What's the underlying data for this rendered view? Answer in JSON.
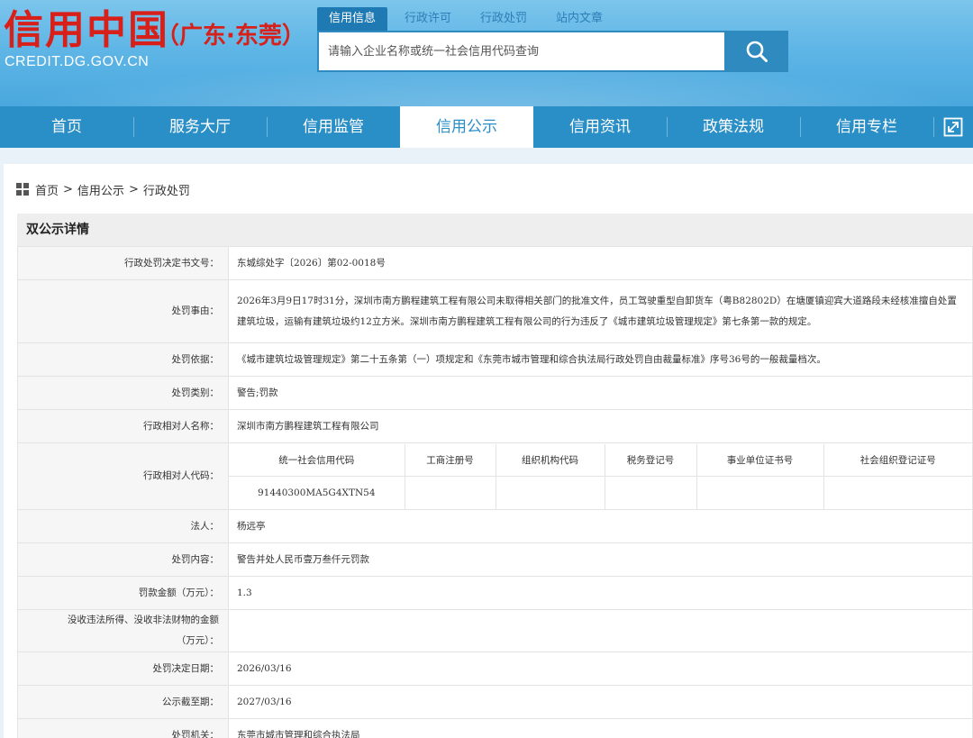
{
  "header": {
    "logo_title": "信用中国",
    "logo_region": "（广东·东莞）",
    "logo_url": "CREDIT.DG.GOV.CN",
    "search_tabs": [
      "信用信息",
      "行政许可",
      "行政处罚",
      "站内文章"
    ],
    "search_placeholder": "请输入企业名称或统一社会信用代码查询",
    "search_icon": "search-icon"
  },
  "nav": {
    "items": [
      "首页",
      "服务大厅",
      "信用监管",
      "信用公示",
      "信用资讯",
      "政策法规",
      "信用专栏"
    ],
    "active_index": 3,
    "expand_icon": "expand-icon"
  },
  "breadcrumb": [
    "首页",
    "信用公示",
    "行政处罚"
  ],
  "detail": {
    "title": "双公示详情",
    "rows": {
      "decision_no": {
        "label": "行政处罚决定书文号：",
        "value": "东城综处字〔2026〕第02-0018号"
      },
      "reason": {
        "label": "处罚事由：",
        "value": "2026年3月9日17时31分，深圳市南方鹏程建筑工程有限公司未取得相关部门的批准文件，员工驾驶重型自卸货车（粤B82802D）在塘厦镇迎宾大道路段未经核准擅自处置建筑垃圾，运输有建筑垃圾约12立方米。深圳市南方鹏程建筑工程有限公司的行为违反了《城市建筑垃圾管理规定》第七条第一款的规定。"
      },
      "basis": {
        "label": "处罚依据：",
        "value": "《城市建筑垃圾管理规定》第二十五条第（一）项规定和《东莞市城市管理和综合执法局行政处罚自由裁量标准》序号36号的一般裁量档次。"
      },
      "category": {
        "label": "处罚类别：",
        "value": "警告;罚款"
      },
      "party_name": {
        "label": "行政相对人名称：",
        "value": "深圳市南方鹏程建筑工程有限公司"
      },
      "party_code": {
        "label": "行政相对人代码：",
        "headers": [
          "统一社会信用代码",
          "工商注册号",
          "组织机构代码",
          "税务登记号",
          "事业单位证书号",
          "社会组织登记证号"
        ],
        "values": [
          "91440300MA5G4XTN54",
          "",
          "",
          "",
          "",
          ""
        ]
      },
      "legal_person": {
        "label": "法人：",
        "value": "杨远亭"
      },
      "content": {
        "label": "处罚内容：",
        "value": "警告并处人民币壹万叁仟元罚款"
      },
      "fine": {
        "label": "罚款金额（万元）：",
        "value": "1.3"
      },
      "confiscation": {
        "label": "没收违法所得、没收非法财物的金额（万元）：",
        "value": ""
      },
      "decision_date": {
        "label": "处罚决定日期：",
        "value": "2026/03/16"
      },
      "public_until": {
        "label": "公示截至期：",
        "value": "2027/03/16"
      },
      "authority": {
        "label": "处罚机关：",
        "value": "东莞市城市管理和综合执法局"
      }
    }
  },
  "colors": {
    "header_top": "#7cc5ec",
    "nav_bg": "#2a8ec7",
    "logo_red": "#d8201b",
    "search_btn": "#2f8ac0"
  }
}
